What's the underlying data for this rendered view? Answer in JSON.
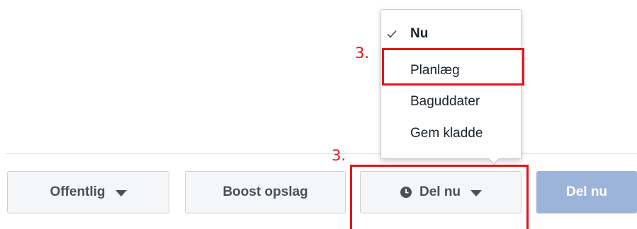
{
  "buttons": {
    "privacy_label": "Offentlig",
    "boost_label": "Boost opslag",
    "schedule_label": "Del nu",
    "share_label": "Del nu"
  },
  "menu": {
    "items": [
      {
        "label": "Nu",
        "checked": true
      },
      {
        "label": "Planlæg",
        "checked": false
      },
      {
        "label": "Baguddater",
        "checked": false
      },
      {
        "label": "Gem kladde",
        "checked": false
      }
    ]
  },
  "annotations": {
    "menu_step": "3.",
    "button_step": "3."
  },
  "colors": {
    "highlight": "#e0161c",
    "share_button_disabled": "#9cb4d8",
    "button_bg": "#f5f6f7"
  },
  "icons": {
    "clock": "clock-icon",
    "check": "checkmark-icon",
    "caret": "caret-down-icon"
  }
}
